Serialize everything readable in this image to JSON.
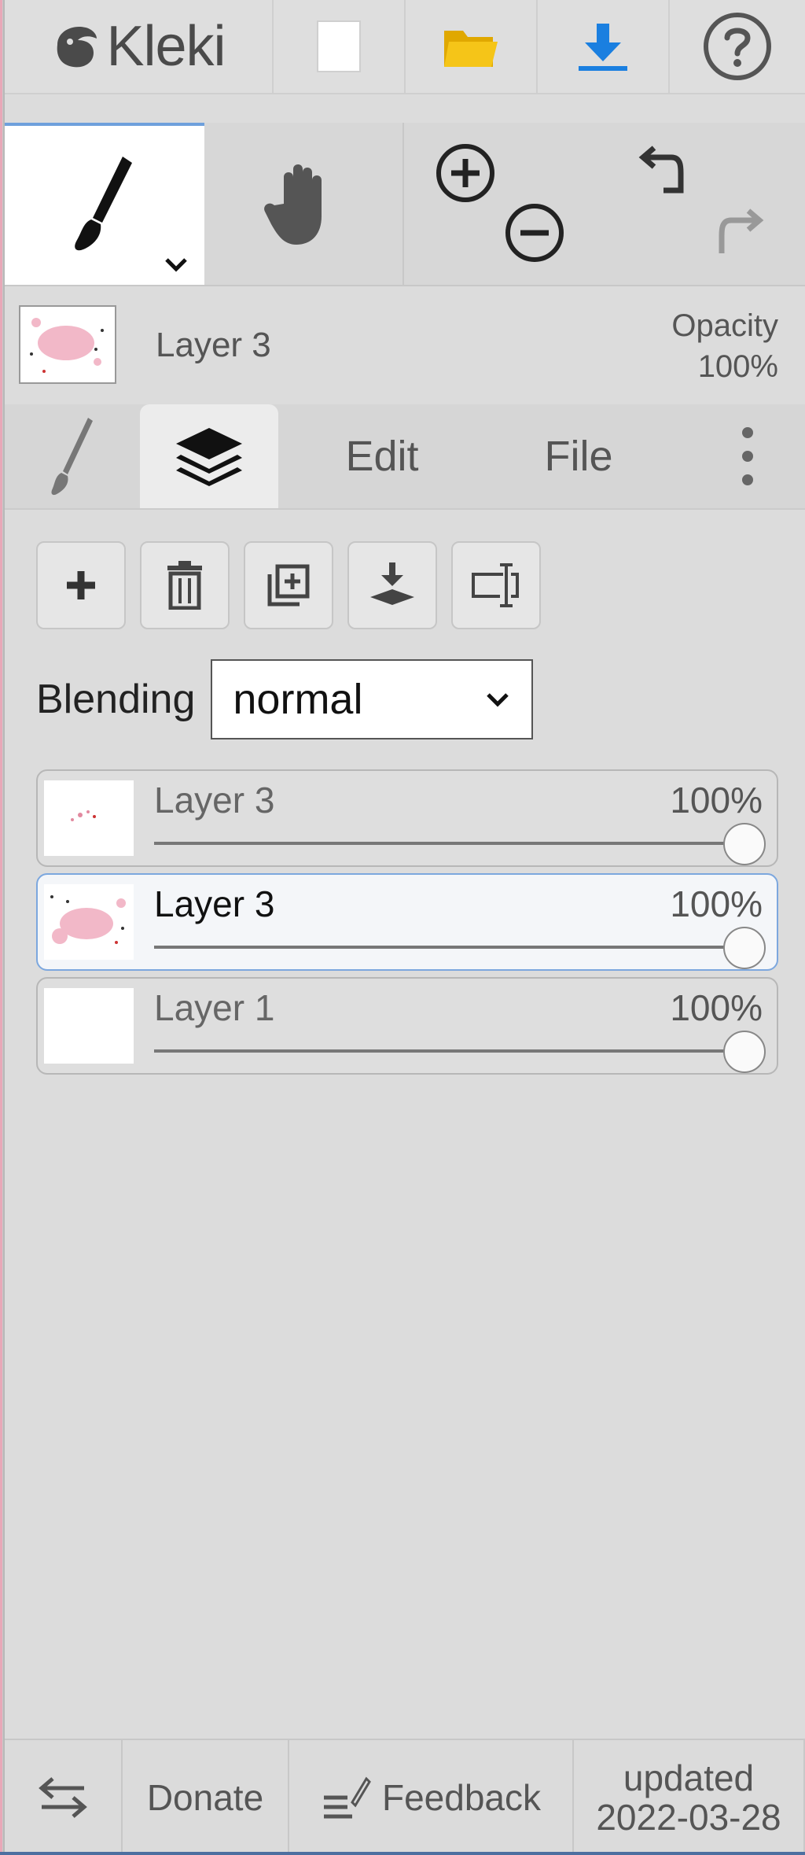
{
  "app": {
    "name": "Kleki"
  },
  "toolbar": {
    "new_icon": "new-file-icon",
    "open_icon": "folder-icon",
    "save_icon": "download-icon",
    "help_icon": "help-icon",
    "colors": {
      "folder": "#f5c518",
      "download": "#1a7fe0"
    }
  },
  "tools": {
    "brush": "brush-icon",
    "hand": "hand-icon",
    "zoom_in": "zoom-in-icon",
    "zoom_out": "zoom-out-icon",
    "undo": "undo-icon",
    "redo": "redo-icon"
  },
  "current_layer": {
    "name": "Layer 3",
    "opacity_label": "Opacity",
    "opacity_value": "100%"
  },
  "tabs": {
    "edit": "Edit",
    "file": "File"
  },
  "layer_panel": {
    "blending_label": "Blending",
    "blending_value": "normal",
    "layers": [
      {
        "name": "Layer 3",
        "opacity": "100%",
        "active": false,
        "thumb": "checker"
      },
      {
        "name": "Layer 3",
        "opacity": "100%",
        "active": true,
        "thumb": "pink"
      },
      {
        "name": "Layer 1",
        "opacity": "100%",
        "active": false,
        "thumb": "white"
      }
    ]
  },
  "footer": {
    "donate": "Donate",
    "feedback": "Feedback",
    "updated_label": "updated",
    "updated_date": "2022-03-28"
  }
}
